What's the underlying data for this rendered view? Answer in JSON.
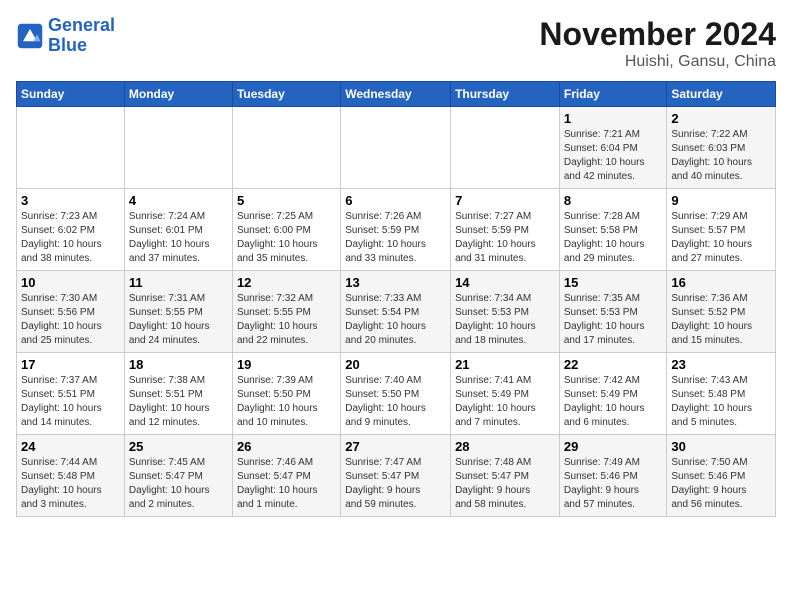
{
  "header": {
    "logo_line1": "General",
    "logo_line2": "Blue",
    "title": "November 2024",
    "subtitle": "Huishi, Gansu, China"
  },
  "days_of_week": [
    "Sunday",
    "Monday",
    "Tuesday",
    "Wednesday",
    "Thursday",
    "Friday",
    "Saturday"
  ],
  "weeks": [
    [
      {
        "num": "",
        "info": ""
      },
      {
        "num": "",
        "info": ""
      },
      {
        "num": "",
        "info": ""
      },
      {
        "num": "",
        "info": ""
      },
      {
        "num": "",
        "info": ""
      },
      {
        "num": "1",
        "info": "Sunrise: 7:21 AM\nSunset: 6:04 PM\nDaylight: 10 hours\nand 42 minutes."
      },
      {
        "num": "2",
        "info": "Sunrise: 7:22 AM\nSunset: 6:03 PM\nDaylight: 10 hours\nand 40 minutes."
      }
    ],
    [
      {
        "num": "3",
        "info": "Sunrise: 7:23 AM\nSunset: 6:02 PM\nDaylight: 10 hours\nand 38 minutes."
      },
      {
        "num": "4",
        "info": "Sunrise: 7:24 AM\nSunset: 6:01 PM\nDaylight: 10 hours\nand 37 minutes."
      },
      {
        "num": "5",
        "info": "Sunrise: 7:25 AM\nSunset: 6:00 PM\nDaylight: 10 hours\nand 35 minutes."
      },
      {
        "num": "6",
        "info": "Sunrise: 7:26 AM\nSunset: 5:59 PM\nDaylight: 10 hours\nand 33 minutes."
      },
      {
        "num": "7",
        "info": "Sunrise: 7:27 AM\nSunset: 5:59 PM\nDaylight: 10 hours\nand 31 minutes."
      },
      {
        "num": "8",
        "info": "Sunrise: 7:28 AM\nSunset: 5:58 PM\nDaylight: 10 hours\nand 29 minutes."
      },
      {
        "num": "9",
        "info": "Sunrise: 7:29 AM\nSunset: 5:57 PM\nDaylight: 10 hours\nand 27 minutes."
      }
    ],
    [
      {
        "num": "10",
        "info": "Sunrise: 7:30 AM\nSunset: 5:56 PM\nDaylight: 10 hours\nand 25 minutes."
      },
      {
        "num": "11",
        "info": "Sunrise: 7:31 AM\nSunset: 5:55 PM\nDaylight: 10 hours\nand 24 minutes."
      },
      {
        "num": "12",
        "info": "Sunrise: 7:32 AM\nSunset: 5:55 PM\nDaylight: 10 hours\nand 22 minutes."
      },
      {
        "num": "13",
        "info": "Sunrise: 7:33 AM\nSunset: 5:54 PM\nDaylight: 10 hours\nand 20 minutes."
      },
      {
        "num": "14",
        "info": "Sunrise: 7:34 AM\nSunset: 5:53 PM\nDaylight: 10 hours\nand 18 minutes."
      },
      {
        "num": "15",
        "info": "Sunrise: 7:35 AM\nSunset: 5:53 PM\nDaylight: 10 hours\nand 17 minutes."
      },
      {
        "num": "16",
        "info": "Sunrise: 7:36 AM\nSunset: 5:52 PM\nDaylight: 10 hours\nand 15 minutes."
      }
    ],
    [
      {
        "num": "17",
        "info": "Sunrise: 7:37 AM\nSunset: 5:51 PM\nDaylight: 10 hours\nand 14 minutes."
      },
      {
        "num": "18",
        "info": "Sunrise: 7:38 AM\nSunset: 5:51 PM\nDaylight: 10 hours\nand 12 minutes."
      },
      {
        "num": "19",
        "info": "Sunrise: 7:39 AM\nSunset: 5:50 PM\nDaylight: 10 hours\nand 10 minutes."
      },
      {
        "num": "20",
        "info": "Sunrise: 7:40 AM\nSunset: 5:50 PM\nDaylight: 10 hours\nand 9 minutes."
      },
      {
        "num": "21",
        "info": "Sunrise: 7:41 AM\nSunset: 5:49 PM\nDaylight: 10 hours\nand 7 minutes."
      },
      {
        "num": "22",
        "info": "Sunrise: 7:42 AM\nSunset: 5:49 PM\nDaylight: 10 hours\nand 6 minutes."
      },
      {
        "num": "23",
        "info": "Sunrise: 7:43 AM\nSunset: 5:48 PM\nDaylight: 10 hours\nand 5 minutes."
      }
    ],
    [
      {
        "num": "24",
        "info": "Sunrise: 7:44 AM\nSunset: 5:48 PM\nDaylight: 10 hours\nand 3 minutes."
      },
      {
        "num": "25",
        "info": "Sunrise: 7:45 AM\nSunset: 5:47 PM\nDaylight: 10 hours\nand 2 minutes."
      },
      {
        "num": "26",
        "info": "Sunrise: 7:46 AM\nSunset: 5:47 PM\nDaylight: 10 hours\nand 1 minute."
      },
      {
        "num": "27",
        "info": "Sunrise: 7:47 AM\nSunset: 5:47 PM\nDaylight: 9 hours\nand 59 minutes."
      },
      {
        "num": "28",
        "info": "Sunrise: 7:48 AM\nSunset: 5:47 PM\nDaylight: 9 hours\nand 58 minutes."
      },
      {
        "num": "29",
        "info": "Sunrise: 7:49 AM\nSunset: 5:46 PM\nDaylight: 9 hours\nand 57 minutes."
      },
      {
        "num": "30",
        "info": "Sunrise: 7:50 AM\nSunset: 5:46 PM\nDaylight: 9 hours\nand 56 minutes."
      }
    ]
  ]
}
